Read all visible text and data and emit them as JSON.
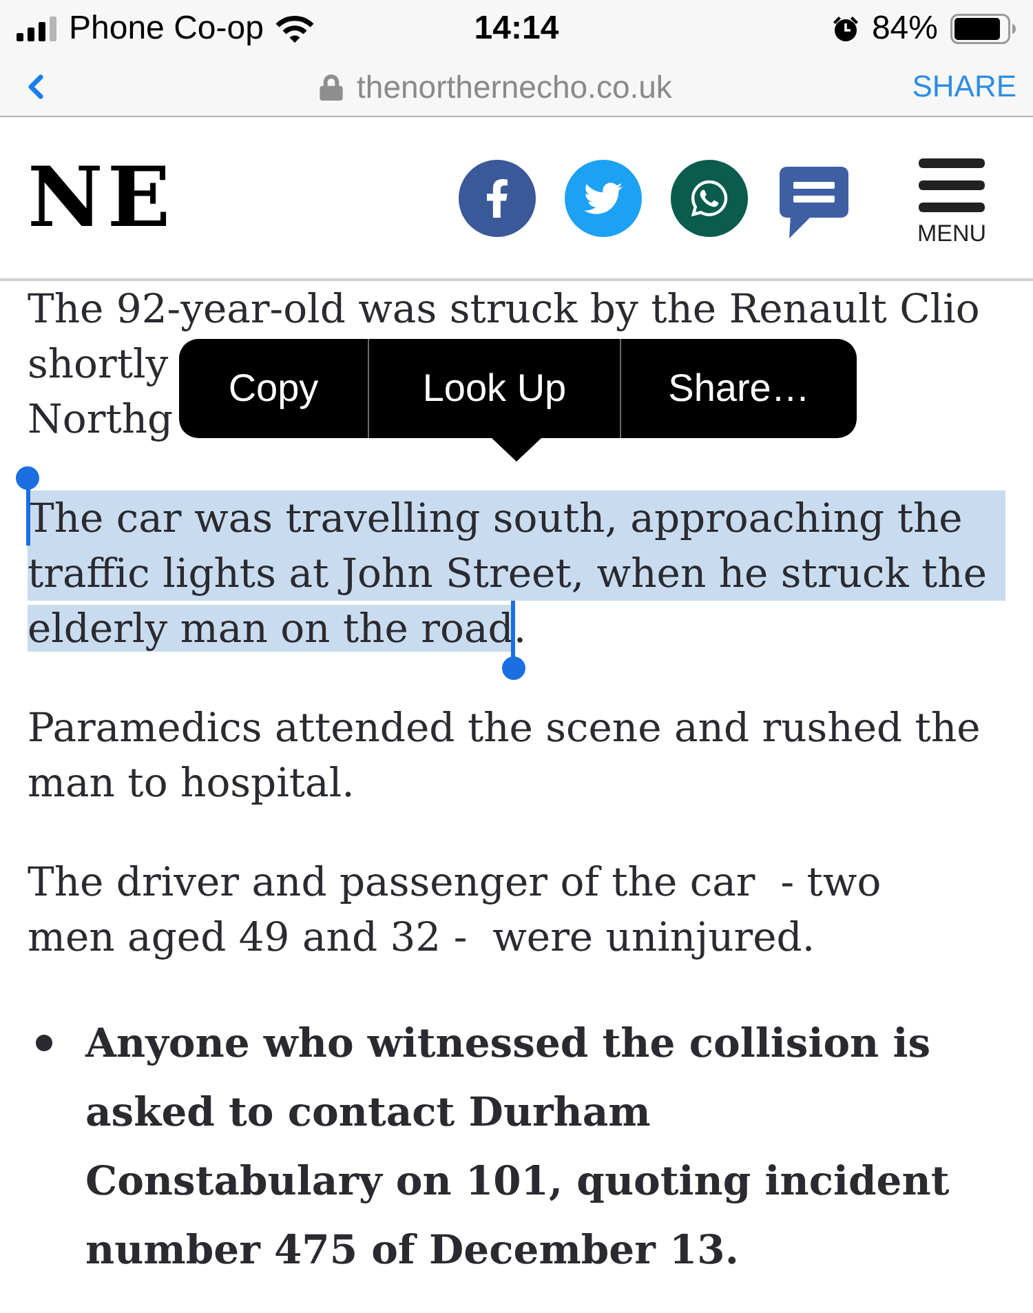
{
  "status_bar": {
    "carrier": "Phone Co-op",
    "time": "14:14",
    "battery": "84%"
  },
  "address_bar": {
    "url": "thenorthernecho.co.uk",
    "share": "SHARE"
  },
  "header": {
    "logo": "NE",
    "menu_label": "MENU"
  },
  "article": {
    "paragraphs": [
      {
        "kind": "covered",
        "lines": [
          "The 92-year-old was struck by the Renault Clio",
          "shortly",
          "Northg"
        ],
        "selected": false
      },
      {
        "kind": "text",
        "lines": [
          "The car was travelling south, approaching the",
          "traffic lights at John Street, when he struck the",
          "elderly man on the road"
        ],
        "unselected_end": ".",
        "selected": true
      },
      {
        "kind": "text",
        "lines": [
          "Paramedics attended the scene and rushed the",
          "man to hospital."
        ],
        "selected": false
      },
      {
        "kind": "text",
        "lines": [
          "The driver and passenger of the car  - two",
          "men aged 49 and 32 -  were uninjured."
        ],
        "selected": false
      }
    ],
    "bullets": [
      {
        "lines": [
          "Anyone who witnessed the collision is",
          "asked to contact Durham",
          "Constabulary on 101, quoting incident",
          "number 475 of December 13."
        ]
      }
    ]
  },
  "context_menu": {
    "items": [
      "Copy",
      "Look Up",
      "Share…"
    ]
  }
}
